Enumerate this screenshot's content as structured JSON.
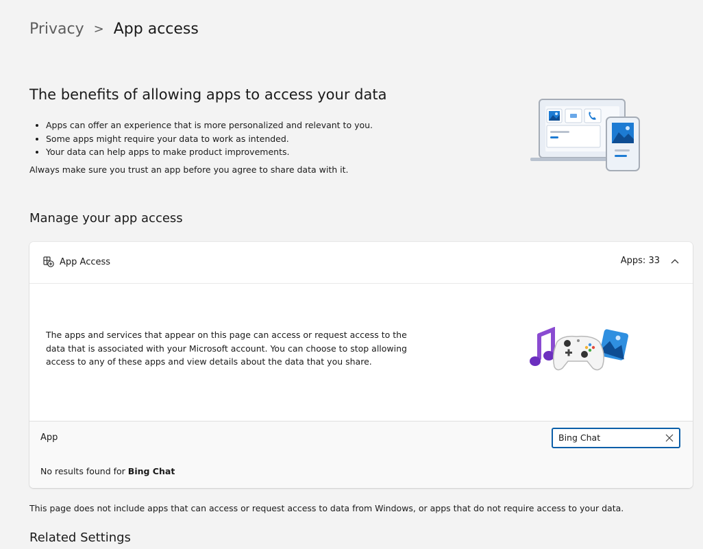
{
  "breadcrumb": {
    "parent": "Privacy",
    "separator": ">",
    "current": "App access"
  },
  "benefits": {
    "title": "The benefits of allowing apps to access your data",
    "bullets": [
      "Apps can offer an experience that is more personalized and relevant to you.",
      "Some apps might require your data to work as intended.",
      "Your data can help apps to make product improvements."
    ],
    "note": "Always make sure you trust an app before you agree to share data with it."
  },
  "manage": {
    "title": "Manage your app access",
    "card": {
      "label": "App Access",
      "count": "Apps: 33",
      "description": "The apps and services that appear on this page can access or request access to the data that is associated with your Microsoft account. You can choose to stop allowing access to any of these apps and view details about the data that you share."
    },
    "table": {
      "column_header": "App",
      "search_value": "Bing Chat",
      "no_results_prefix": "No results found for",
      "no_results_query": "Bing Chat"
    }
  },
  "footer_note": "This page does not include apps that can access or request access to data from Windows, or apps that do not require access to your data.",
  "related": {
    "title": "Related Settings"
  },
  "colors": {
    "accent": "#0a5ea8",
    "background": "#f3f3f3",
    "card": "#ffffff"
  },
  "icons": {
    "card_header": "app-access-icon",
    "chevron": "chevron-up-icon",
    "clear": "close-icon"
  }
}
